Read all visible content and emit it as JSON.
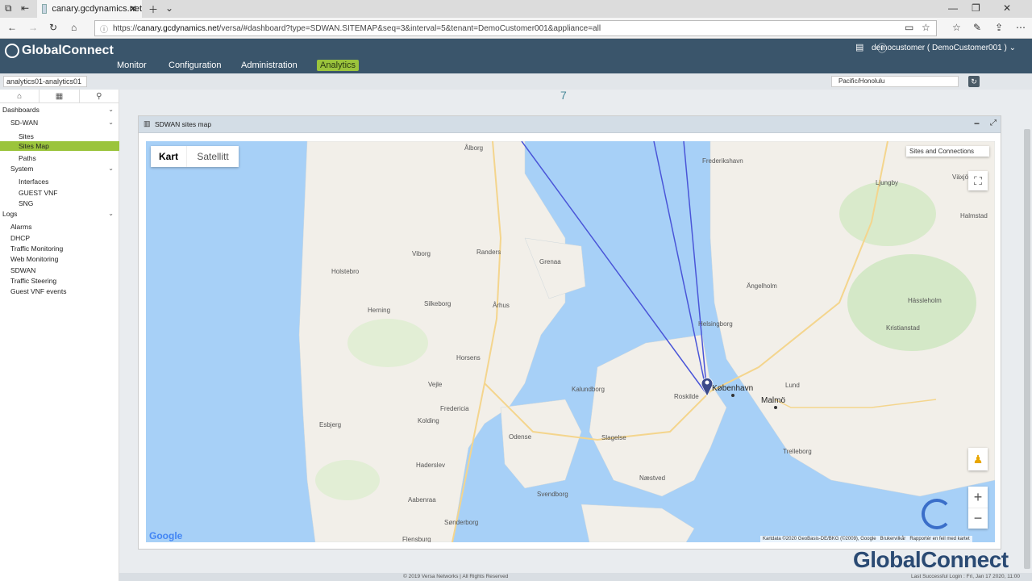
{
  "browser": {
    "tab_title": "canary.gcdynamics.net",
    "url_prefix": "https://",
    "url_host": "canary.gcdynamics.net",
    "url_path": "/versa/#dashboard?type=SDWAN.SITEMAP&seq=3&interval=5&tenant=DemoCustomer001&appliance=all"
  },
  "header": {
    "logo_text": "GlobalConnect",
    "nav": [
      "Monitor",
      "Configuration",
      "Administration",
      "Analytics"
    ],
    "active_nav": "Analytics",
    "user": "democustomer ( DemoCustomer001 )"
  },
  "subbar": {
    "appliance": "analytics01-analytics01",
    "timezone": "Pacific/Honolulu"
  },
  "sidebar": {
    "dashboards": "Dashboards",
    "sdwan": "SD-WAN",
    "sites": "Sites",
    "sites_map": "Sites Map",
    "paths": "Paths",
    "system": "System",
    "interfaces": "Interfaces",
    "guest_vnf": "GUEST VNF",
    "sng": "SNG",
    "logs": "Logs",
    "alarms": "Alarms",
    "dhcp": "DHCP",
    "traffic_monitoring": "Traffic Monitoring",
    "web_monitoring": "Web Monitoring",
    "sdwan_log": "SDWAN",
    "traffic_steering": "Traffic Steering",
    "guest_vnf_events": "Guest VNF events"
  },
  "main": {
    "page_number": "7",
    "panel_title": "SDWAN sites map",
    "map_type_kart": "Kart",
    "map_type_satellitt": "Satellitt",
    "sites_dropdown": "Sites and Connections",
    "attribution": "Kartdata ©2020 GeoBasis-DE/BKG (©2009), Google",
    "terms": "Brukervilkår",
    "report": "Rapportér en feil med kartet",
    "google": "Google",
    "map_labels": [
      "Ålborg",
      "Randers",
      "Viborg",
      "Holstebro",
      "Herning",
      "Silkeborg",
      "Århus",
      "Horsens",
      "Vejle",
      "Kolding",
      "Esbjerg",
      "Fredericia",
      "Odense",
      "Svendborg",
      "Aabenraa",
      "Sønderborg",
      "Flensburg",
      "Kalundborg",
      "Slagelse",
      "Roskilde",
      "København",
      "Næstved",
      "Helsingborg",
      "Halmstad",
      "Malmö",
      "Lund",
      "Trelleborg",
      "Kristianstad",
      "Ljungby",
      "Växjö",
      "Ängelholm",
      "Hässleholm",
      "Haderslev",
      "Grenaa",
      "Frederikshavn"
    ]
  },
  "footer": {
    "copyright": "© 2019 Versa Networks | All Rights Reserved",
    "last_login": "Last Successful Login : Fri, Jan 17 2020, 11:00"
  },
  "watermark": "GlobalConnect",
  "colors": {
    "header_bg": "#3a556b",
    "accent_green": "#9bc43c",
    "map_water": "#a7d0f7",
    "map_land": "#f2efe9",
    "link_line": "#4a55d8"
  }
}
